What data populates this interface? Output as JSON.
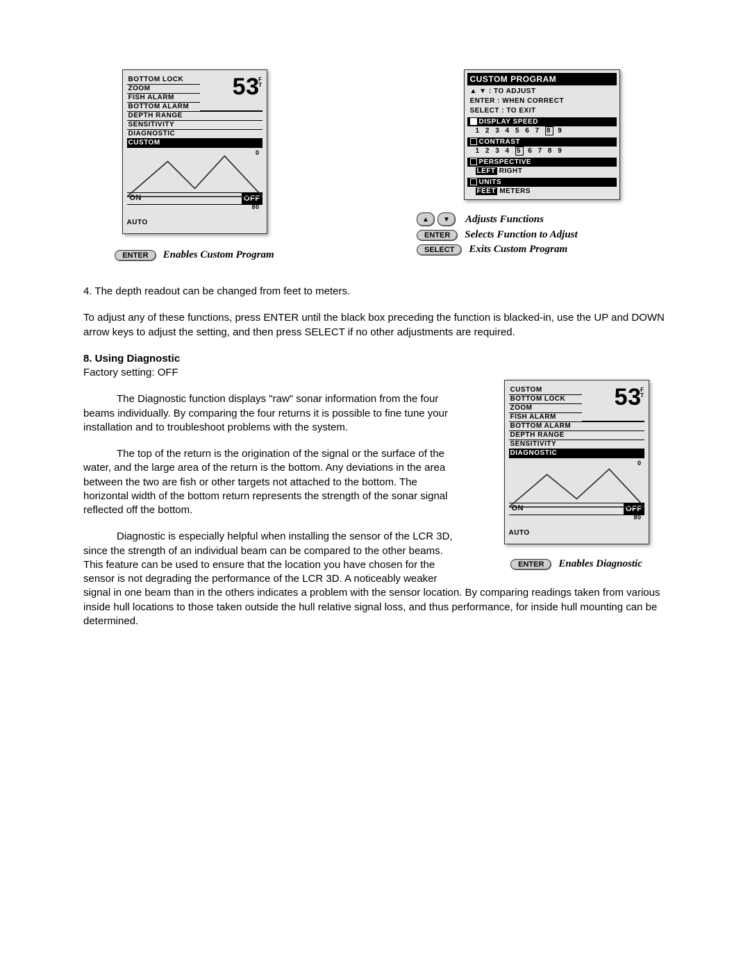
{
  "left_screen": {
    "menu": [
      "BOTTOM LOCK",
      "ZOOM",
      "FISH ALARM",
      "BOTTOM ALARM",
      "DEPTH RANGE",
      "SENSITIVITY",
      "DIAGNOSTIC",
      "CUSTOM"
    ],
    "selected": "CUSTOM",
    "depth_value": "53",
    "depth_unit_top": "F",
    "depth_unit_bot": "T",
    "on_label": "ON",
    "off_label": "OFF",
    "auto_label": "AUTO",
    "marker_top": "0",
    "marker_bottom": "80"
  },
  "left_legend": {
    "enter_key": "ENTER",
    "enter_text": "Enables Custom Program"
  },
  "custom_program": {
    "title": "CUSTOM PROGRAM",
    "hint_arrows": "▲   ▼ : TO ADJUST",
    "hint_enter": "ENTER  : WHEN CORRECT",
    "hint_select": "SELECT : TO EXIT",
    "display_speed_label": "DISPLAY SPEED",
    "display_speed_values": [
      "1",
      "2",
      "3",
      "4",
      "5",
      "6",
      "7",
      "8",
      "9"
    ],
    "display_speed_current": "8",
    "contrast_label": "CONTRAST",
    "contrast_values": [
      "1",
      "2",
      "3",
      "4",
      "5",
      "6",
      "7",
      "8",
      "9"
    ],
    "contrast_current": "5",
    "perspective_label": "PERSPECTIVE",
    "perspective_options": [
      "LEFT",
      "RIGHT"
    ],
    "perspective_selected": "LEFT",
    "units_label": "UNITS",
    "units_options": [
      "FEET",
      "METERS"
    ],
    "units_selected": "FEET"
  },
  "right_legend": {
    "arrows_text": "Adjusts Functions",
    "enter_key": "ENTER",
    "enter_text": "Selects Function to Adjust",
    "select_key": "SELECT",
    "select_text": "Exits Custom Program"
  },
  "body": {
    "p1": "4. The depth readout can be changed from feet to meters.",
    "p2": "To adjust any of these functions, press ENTER until the black box preceding the function is blacked-in, use the UP and DOWN arrow keys to adjust the setting, and then press SELECT if no other adjustments are required.",
    "heading": "8. Using Diagnostic",
    "factory": "Factory setting: OFF",
    "p3": "The Diagnostic function displays \"raw\" sonar information from the four beams individually. By comparing the four returns it is possible to fine tune your installation and to troubleshoot problems with the system.",
    "p4": "The top of the return is the origination of the signal or the surface of the water, and the large area of the return is the bottom. Any deviations in the area between the two are fish or other targets not attached to the bottom. The horizontal width of the bottom return represents the strength of the sonar signal reflected off the bottom.",
    "p5": "Diagnostic is especially helpful when installing the sensor of the LCR 3D, since the strength of an individual beam can be compared to the other beams. This feature can be used to ensure that the location you have chosen for the sensor is not degrading the performance of the LCR 3D. A noticeably weaker signal in one beam than in the others indicates a problem with the sensor location. By comparing readings taken from various inside hull locations to those taken outside the hull relative signal loss, and thus performance, for inside hull mounting can be determined."
  },
  "diag_screen": {
    "menu": [
      "CUSTOM",
      "BOTTOM LOCK",
      "ZOOM",
      "FISH ALARM",
      "BOTTOM ALARM",
      "DEPTH RANGE",
      "SENSITIVITY",
      "DIAGNOSTIC"
    ],
    "selected": "DIAGNOSTIC",
    "depth_value": "53",
    "depth_unit_top": "F",
    "depth_unit_bot": "T",
    "on_label": "ON",
    "off_label": "OFF",
    "auto_label": "AUTO",
    "marker_top": "0",
    "marker_bottom": "80"
  },
  "diag_legend": {
    "enter_key": "ENTER",
    "enter_text": "Enables Diagnostic"
  }
}
